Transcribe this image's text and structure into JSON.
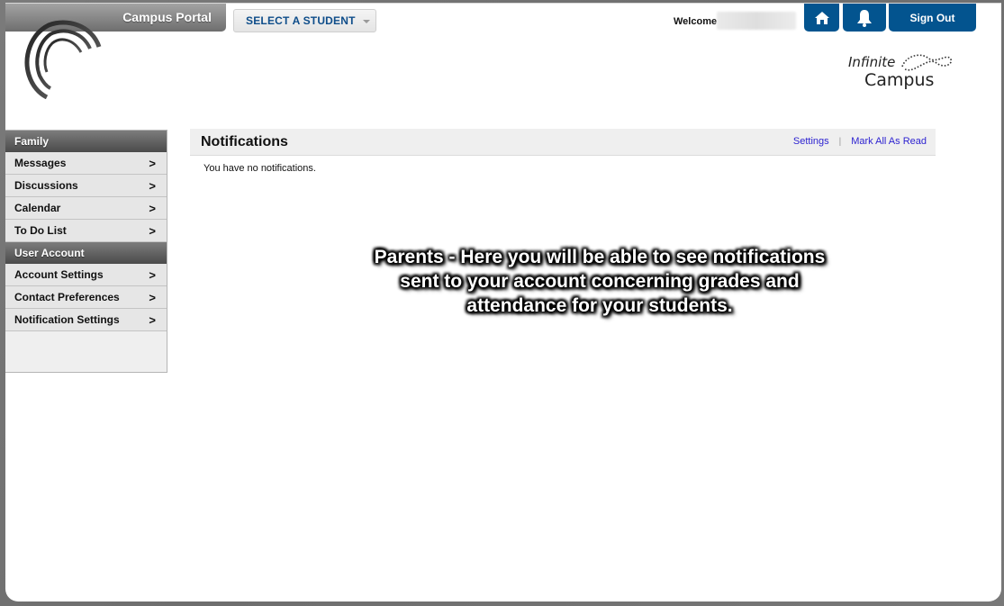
{
  "header": {
    "app_title": "Campus Portal",
    "student_select": {
      "label": "SELECT A STUDENT",
      "icon": "chevron-down-icon"
    },
    "welcome_label": "Welcome",
    "welcome_name": "",
    "buttons": [
      {
        "name": "home",
        "icon": "home-icon"
      },
      {
        "name": "notifications",
        "icon": "bell-icon"
      },
      {
        "name": "sign-out",
        "label": "Sign Out"
      }
    ],
    "brand_logo": {
      "line1": "Infinite",
      "line2": "Campus"
    }
  },
  "sidebar": {
    "sections": [
      {
        "title": "Family",
        "items": [
          {
            "label": "Messages",
            "chevron": ">"
          },
          {
            "label": "Discussions",
            "chevron": ">"
          },
          {
            "label": "Calendar",
            "chevron": ">"
          },
          {
            "label": "To Do List",
            "chevron": ">"
          }
        ]
      },
      {
        "title": "User Account",
        "items": [
          {
            "label": "Account Settings",
            "chevron": ">"
          },
          {
            "label": "Contact Preferences",
            "chevron": ">"
          },
          {
            "label": "Notification Settings",
            "chevron": ">"
          }
        ]
      }
    ]
  },
  "main": {
    "title": "Notifications",
    "links": {
      "settings": "Settings",
      "separator": "|",
      "mark_all_read": "Mark All As Read"
    },
    "empty_message": "You have no notifications."
  },
  "annotation": {
    "lines": [
      "Parents - Here you will be able to see notifications",
      "sent to your account concerning grades and",
      "attendance for your students."
    ]
  },
  "colors": {
    "primary_blue": "#03548f",
    "link_blue": "#2a1fd0",
    "select_text": "#0e4d8a"
  }
}
